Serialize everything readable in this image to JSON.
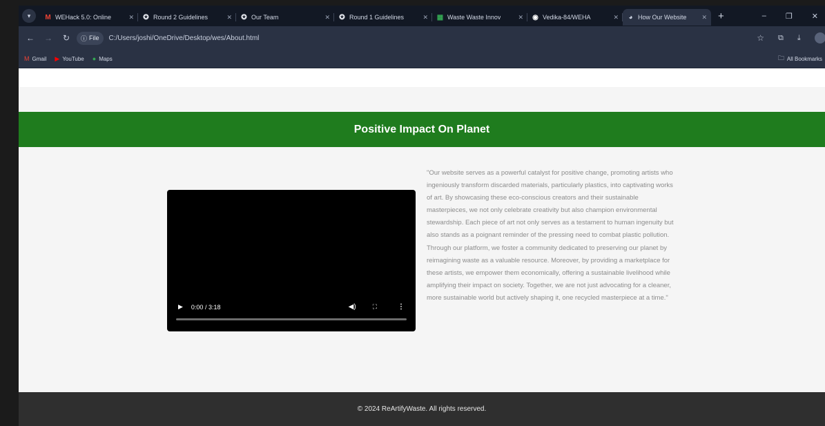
{
  "browser": {
    "tabs": [
      {
        "label": "WEHack 5.0: Online",
        "icon": "gmail-icon",
        "active": false
      },
      {
        "label": "Round 2 Guidelines",
        "icon": "devfolio-icon",
        "active": false
      },
      {
        "label": "Our Team",
        "icon": "devfolio-icon",
        "active": false
      },
      {
        "label": "Round 1 Guidelines",
        "icon": "devfolio-icon",
        "active": false
      },
      {
        "label": "Waste Waste Innov",
        "icon": "sheets-icon",
        "active": false
      },
      {
        "label": "Vedika-84/WEHA",
        "icon": "github-icon",
        "active": false
      },
      {
        "label": "How Our Website",
        "icon": "globe-icon",
        "active": true
      }
    ],
    "address": {
      "chip": "File",
      "url": "C:/Users/joshi/OneDrive/Desktop/wes/About.html"
    },
    "bookmarks": [
      {
        "label": "Gmail",
        "icon": "gmail-icon"
      },
      {
        "label": "YouTube",
        "icon": "youtube-icon"
      },
      {
        "label": "Maps",
        "icon": "maps-icon"
      }
    ],
    "all_bookmarks": "All Bookmarks"
  },
  "page": {
    "banner_title": "Positive Impact On Planet",
    "video": {
      "time": "0:00 / 3:18",
      "progress": 0
    },
    "description": "\"Our website serves as a powerful catalyst for positive change, promoting artists who ingeniously transform discarded materials, particularly plastics, into captivating works of art. By showcasing these eco-conscious creators and their sustainable masterpieces, we not only celebrate creativity but also champion environmental stewardship. Each piece of art not only serves as a testament to human ingenuity but also stands as a poignant reminder of the pressing need to combat plastic pollution. Through our platform, we foster a community dedicated to preserving our planet by reimagining waste as a valuable resource. Moreover, by providing a marketplace for these artists, we empower them economically, offering a sustainable livelihood while amplifying their impact on society. Together, we are not just advocating for a cleaner, more sustainable world but actively shaping it, one recycled masterpiece at a time.\"",
    "footer": "© 2024 ReArtifyWaste. All rights reserved."
  },
  "colors": {
    "banner": "#1f7c1e",
    "footer": "#2f2f2f",
    "browser_chrome": "#2a3244"
  }
}
